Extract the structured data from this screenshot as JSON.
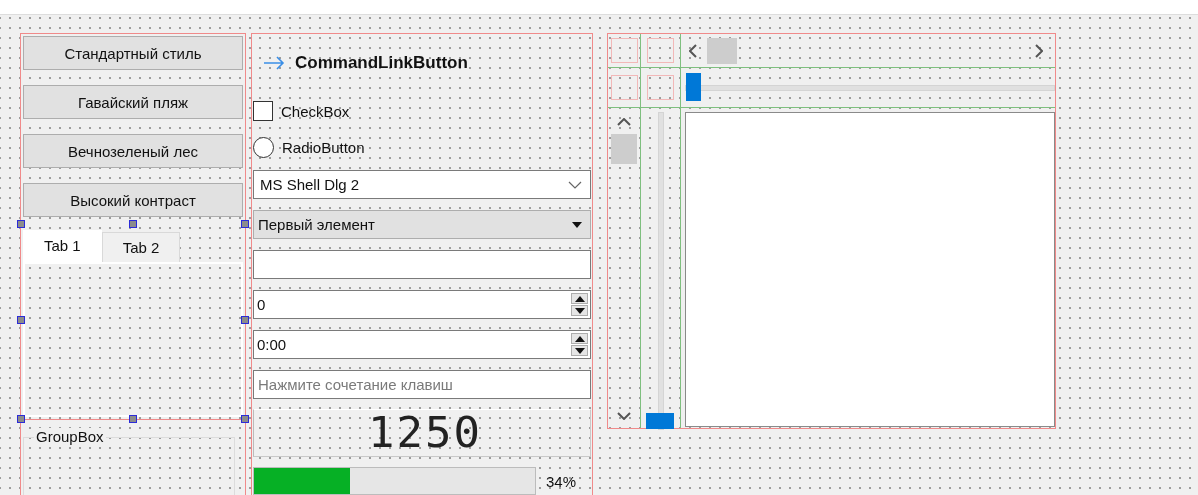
{
  "style_buttons": [
    {
      "label": "Стандартный стиль"
    },
    {
      "label": "Гавайский пляж"
    },
    {
      "label": "Вечнозеленый лес"
    },
    {
      "label": "Высокий контраст"
    }
  ],
  "tabs": [
    {
      "label": "Tab 1",
      "selected": true
    },
    {
      "label": "Tab 2",
      "selected": false
    }
  ],
  "group_box": {
    "title": "GroupBox"
  },
  "command_link": {
    "label": "CommandLinkButton"
  },
  "checkbox": {
    "label": "CheckBox",
    "checked": false
  },
  "radio": {
    "label": "RadioButton",
    "selected": false
  },
  "font_combo": {
    "value": "MS Shell Dlg 2"
  },
  "combo": {
    "value": "Первый элемент"
  },
  "fields": [
    {
      "kind": "line-edit"
    },
    {
      "kind": "spin",
      "value": "0"
    },
    {
      "kind": "spin",
      "value": "0:00"
    },
    {
      "kind": "key-sequence",
      "placeholder": "Нажмите сочетание клавиш"
    }
  ],
  "lcd": {
    "value": "1250"
  },
  "progress": {
    "level": 0.34,
    "text": "34%"
  },
  "sliders": [
    {
      "kind": "horizontal",
      "level": 0
    },
    {
      "kind": "vertical",
      "level": 0
    }
  ]
}
